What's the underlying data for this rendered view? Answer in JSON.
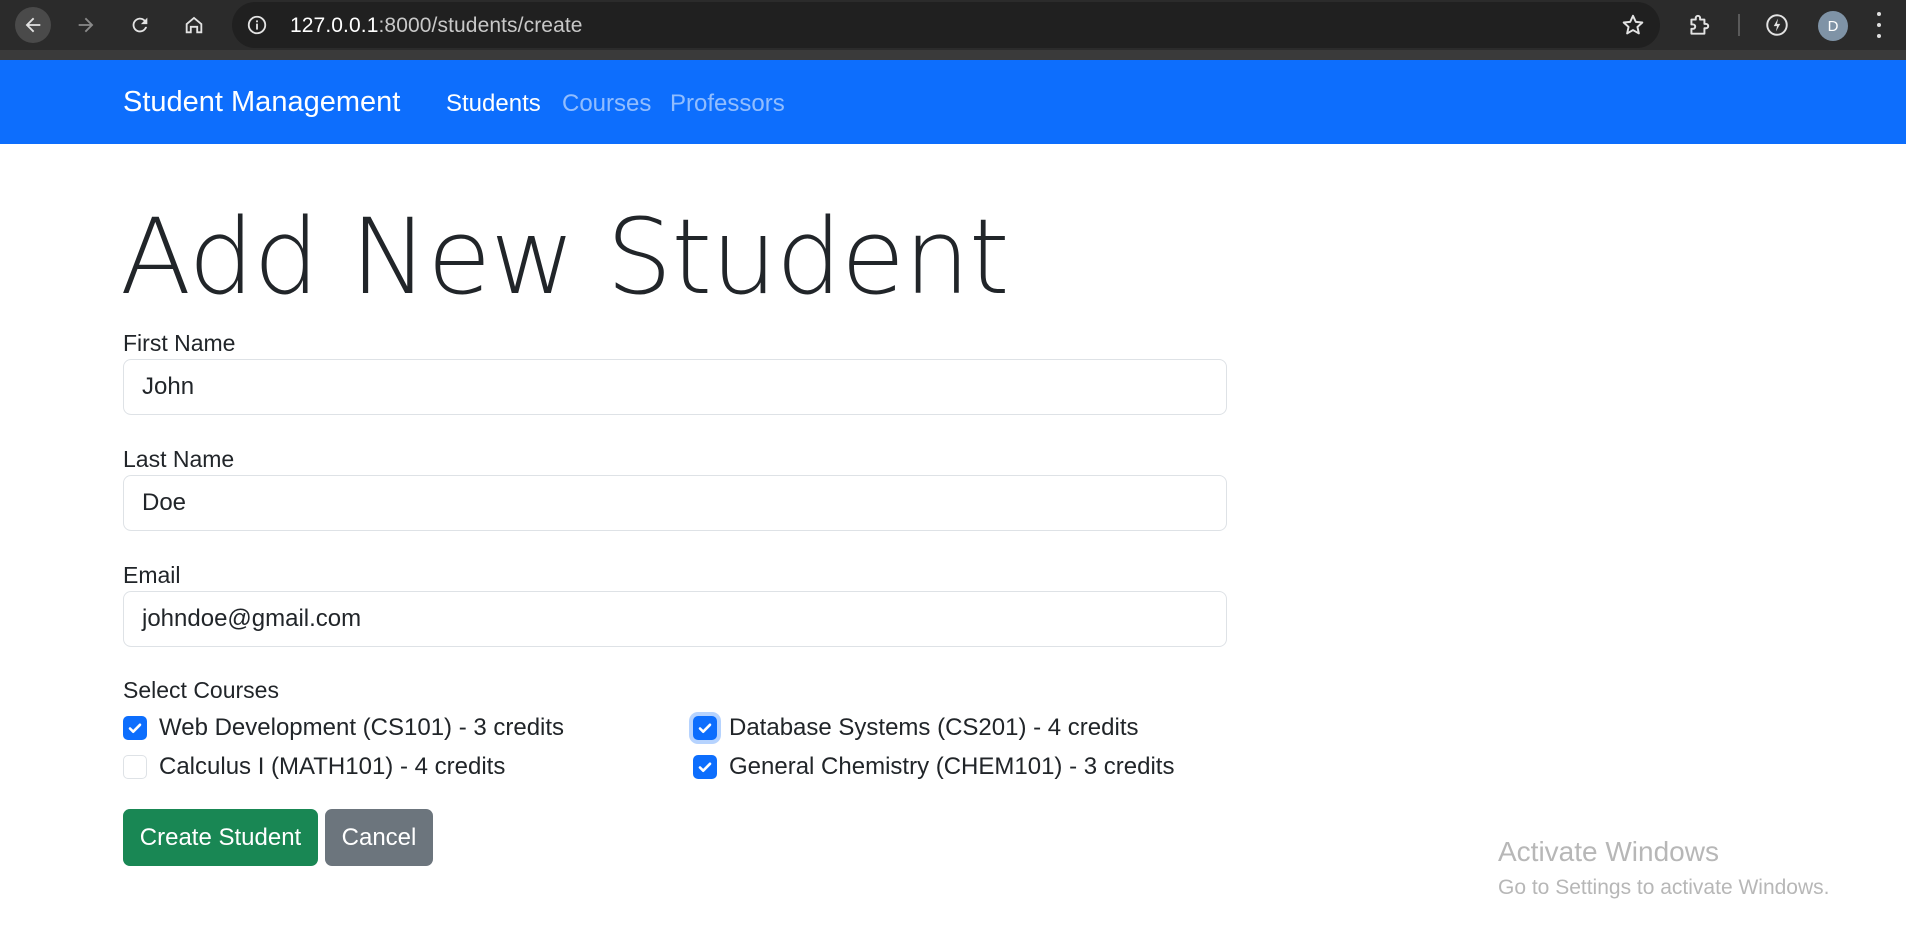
{
  "browser": {
    "url_host": "127.0.0.1",
    "url_path": ":8000/students/create",
    "profile_initial": "D",
    "icons": [
      "back-arrow-icon",
      "forward-arrow-icon",
      "reload-icon",
      "home-icon",
      "site-info-icon",
      "bookmark-star-icon",
      "extensions-puzzle-icon",
      "performance-icon",
      "kebab-menu-icon"
    ]
  },
  "navbar": {
    "brand": "Student Management",
    "links": [
      {
        "label": "Students",
        "active": true
      },
      {
        "label": "Courses",
        "active": false
      },
      {
        "label": "Professors",
        "active": false
      }
    ],
    "color": "#0d6efd"
  },
  "page": {
    "title": "Add New Student"
  },
  "form": {
    "first_name": {
      "label": "First Name",
      "value": "John"
    },
    "last_name": {
      "label": "Last Name",
      "value": "Doe"
    },
    "email": {
      "label": "Email",
      "value": "johndoe@gmail.com"
    },
    "courses_label": "Select Courses",
    "courses": [
      {
        "label": "Web Development (CS101) - 3 credits",
        "checked": true
      },
      {
        "label": "Database Systems (CS201) - 4 credits",
        "checked": true
      },
      {
        "label": "Calculus I (MATH101) - 4 credits",
        "checked": false
      },
      {
        "label": "General Chemistry (CHEM101) - 3 credits",
        "checked": true
      }
    ],
    "submit_label": "Create Student",
    "cancel_label": "Cancel"
  },
  "colors": {
    "primary": "#0d6efd",
    "success": "#198754",
    "secondary": "#6c757d"
  },
  "watermark": {
    "line1": "Activate Windows",
    "line2": "Go to Settings to activate Windows."
  }
}
